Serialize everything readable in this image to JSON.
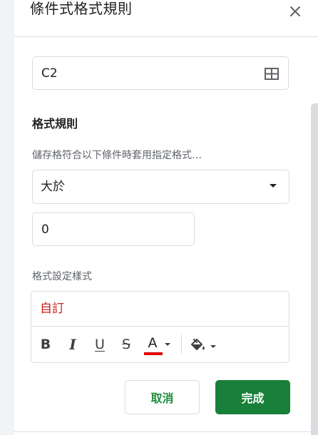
{
  "panel": {
    "title": "條件式格式規則",
    "close_icon": "close-icon"
  },
  "range": {
    "value": "C2",
    "select_range_icon": "grid-icon"
  },
  "format_rules": {
    "heading": "格式規則",
    "condition_label": "儲存格符合以下條件時套用指定格式…",
    "condition_selected": "大於",
    "value": "0"
  },
  "formatting_style": {
    "label": "格式設定樣式",
    "preview_text": "自訂",
    "preview_color": "#c5221f",
    "toolbar": {
      "bold": "B",
      "italic": "I",
      "underline": "U",
      "strikethrough": "S",
      "text_color_letter": "A",
      "text_color": "#e00000",
      "fill_color_icon": "paint-bucket-icon"
    }
  },
  "buttons": {
    "cancel": "取消",
    "done": "完成",
    "done_color": "#188038"
  }
}
